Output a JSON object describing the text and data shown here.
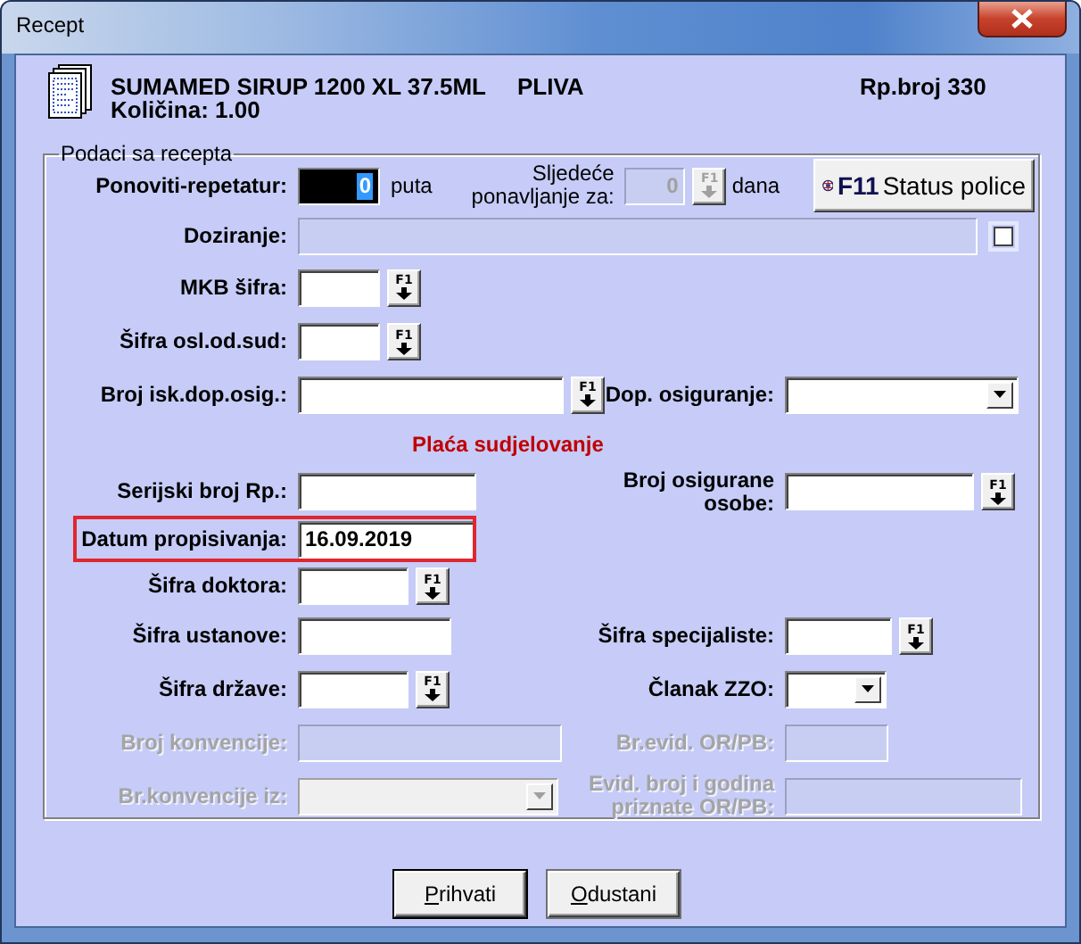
{
  "window": {
    "title": "Recept"
  },
  "header": {
    "product": "SUMAMED SIRUP 1200 XL 37.5ML",
    "manufacturer": "PLIVA",
    "quantity": "Količina: 1.00",
    "prescription_number": "Rp.broj 330"
  },
  "group": {
    "title": "Podaci sa recepta"
  },
  "repeat": {
    "label": "Ponoviti-repetatur:",
    "value": "0",
    "unit": "puta",
    "next_label": "Sljedeće ponavljanje za:",
    "next_value": "0",
    "next_button": "F1",
    "next_disabled": true,
    "next_unit": "dana"
  },
  "status_button": {
    "key": "F11",
    "label": "Status police"
  },
  "dosage": {
    "label": "Doziranje:",
    "disabled": true,
    "checked": false
  },
  "rows": [
    {
      "left": {
        "kind": "lookup",
        "label": "MKB šifra:",
        "button": "F1",
        "disabled": false
      }
    },
    {
      "left": {
        "kind": "lookup",
        "label": "Šifra osl.od.sud:",
        "button": "F1",
        "disabled": false
      }
    },
    {
      "left": {
        "kind": "lookup",
        "label": "Broj isk.dop.osig.:",
        "button": "F1",
        "disabled": false
      },
      "right": {
        "kind": "dropdown",
        "label": "Dop. osiguranje:",
        "disabled": false
      }
    },
    {
      "kind": "notice",
      "text": "Plaća sudjelovanje"
    },
    {
      "left": {
        "kind": "text",
        "label": "Serijski broj Rp.:",
        "disabled": false
      },
      "right": {
        "kind": "lookup",
        "label": "Broj osigurane osobe:",
        "button": "F1",
        "disabled": false
      }
    },
    {
      "highlighted": true,
      "left": {
        "kind": "text",
        "label": "Datum propisivanja:",
        "value": "16.09.2019",
        "disabled": false
      }
    },
    {
      "left": {
        "kind": "lookup",
        "label": "Šifra doktora:",
        "button": "F1",
        "disabled": false
      }
    },
    {
      "left": {
        "kind": "text",
        "label": "Šifra ustanove:",
        "disabled": false
      },
      "right": {
        "kind": "lookup",
        "label": "Šifra specijaliste:",
        "button": "F1",
        "disabled": false
      }
    },
    {
      "left": {
        "kind": "lookup",
        "label": "Šifra države:",
        "button": "F1",
        "disabled": false
      },
      "right": {
        "kind": "dropdown",
        "label": "Članak ZZO:",
        "disabled": false
      }
    },
    {
      "left": {
        "kind": "text",
        "label": "Broj konvencije:",
        "disabled": true
      },
      "right": {
        "kind": "text",
        "label": "Br.evid. OR/PB:",
        "disabled": true
      }
    },
    {
      "left": {
        "kind": "dropdown",
        "label": "Br.konvencije iz:",
        "disabled": true
      },
      "right": {
        "kind": "text",
        "label": "Evid. broj i godina priznate OR/PB:",
        "disabled": true
      }
    }
  ],
  "buttons": [
    {
      "label": "Prihvati"
    },
    {
      "label": "Odustani"
    }
  ]
}
